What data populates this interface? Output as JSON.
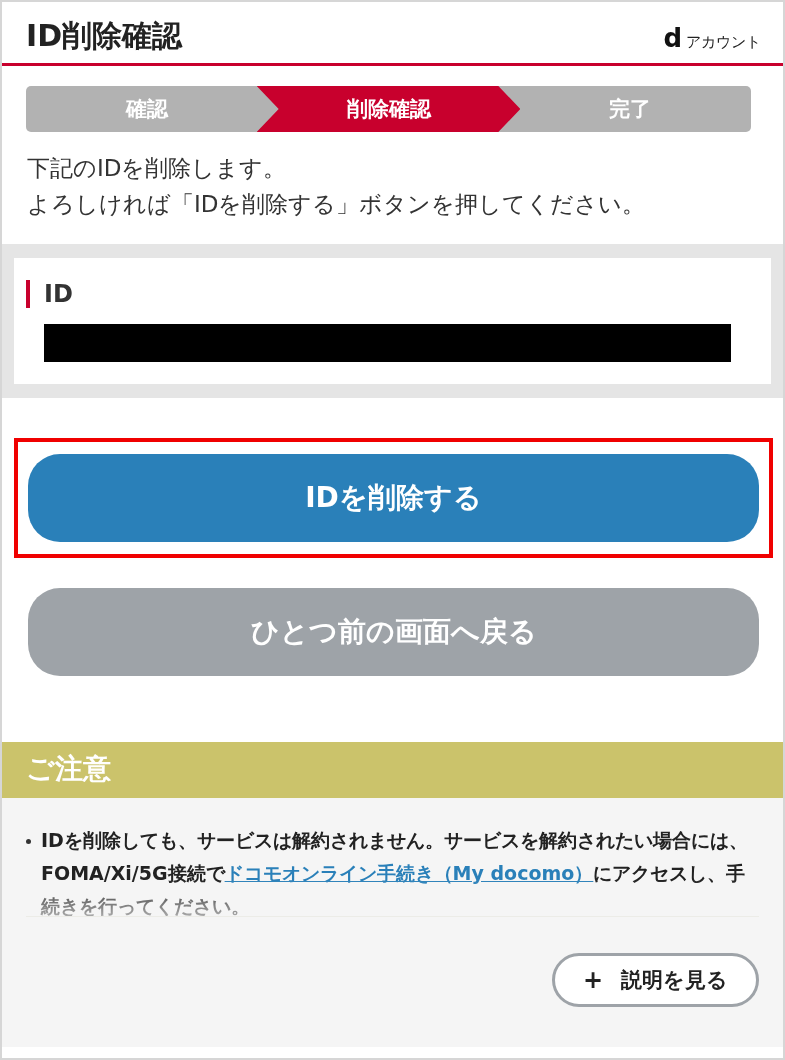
{
  "header": {
    "title": "ID削除確認",
    "brand_mark": "d",
    "brand_text": "アカウント"
  },
  "steps": [
    {
      "label": "確認",
      "selected": false
    },
    {
      "label": "削除確認",
      "selected": true
    },
    {
      "label": "完了",
      "selected": false
    }
  ],
  "intro": [
    "下記のIDを削除します。",
    "よろしければ「IDを削除する」ボタンを押してください。"
  ],
  "id_card": {
    "label": "ID"
  },
  "buttons": [
    {
      "label": "IDを削除する",
      "kind": "primary",
      "highlighted": true
    },
    {
      "label": "ひとつ前の画面へ戻る",
      "kind": "secondary",
      "highlighted": false
    }
  ],
  "notice": {
    "title": "ご注意",
    "items": [
      {
        "text": "IDを削除しても、サービスは解約されません。サービスを解約されたい場合には、FOMA/Xi/5G接続で",
        "link": "ドコモオンライン手続き（My docomo）",
        "after": "にアクセスし、手続きを行ってください。"
      }
    ],
    "more_button": {
      "icon": "+",
      "label": "説明を見る"
    }
  }
}
